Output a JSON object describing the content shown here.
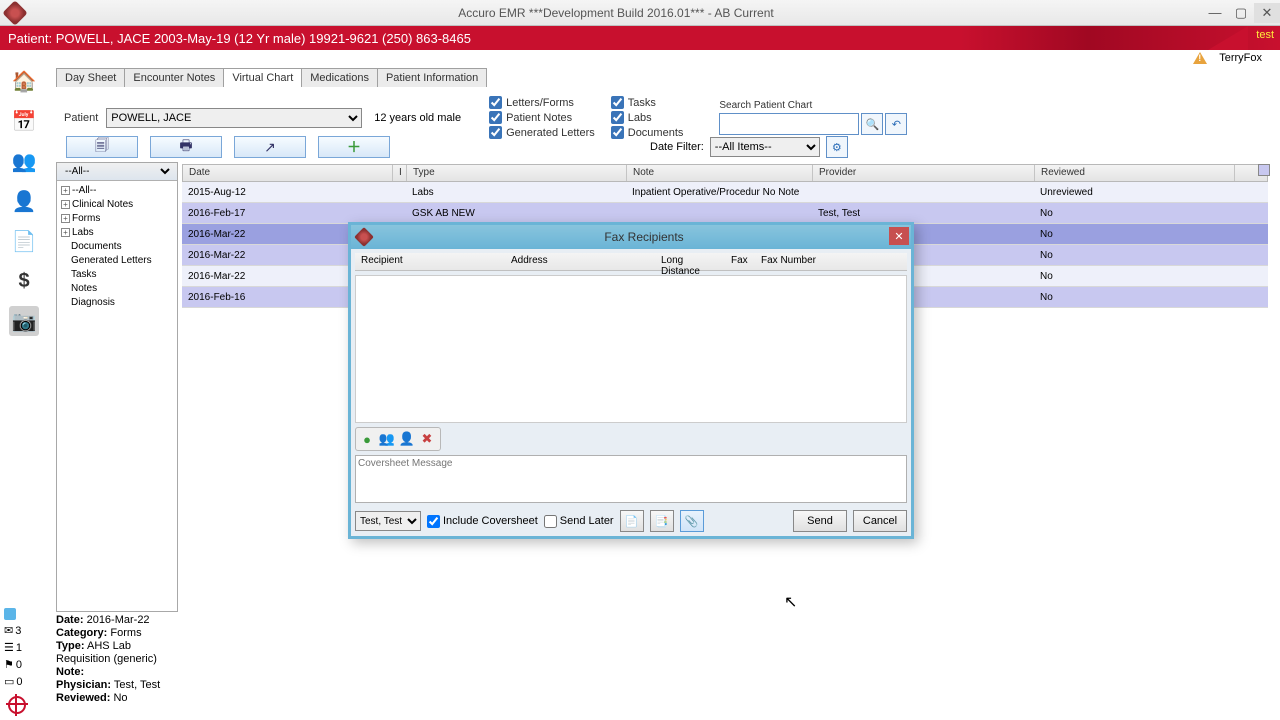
{
  "window": {
    "title": "Accuro EMR ***Development Build 2016.01***  -  AB Current",
    "test_tag": "test"
  },
  "patient_banner": "Patient: POWELL, JACE 2003-May-19 (12 Yr male) 19921-9621 (250) 863-8465",
  "user": "TerryFox",
  "tabs": [
    "Day Sheet",
    "Encounter Notes",
    "Virtual Chart",
    "Medications",
    "Patient Information"
  ],
  "active_tab": "Virtual Chart",
  "patient_row": {
    "label": "Patient",
    "patient": "POWELL, JACE",
    "age": "12 years old male",
    "filters": {
      "letters_forms": "Letters/Forms",
      "patient_notes": "Patient Notes",
      "generated_letters": "Generated Letters",
      "tasks": "Tasks",
      "labs": "Labs",
      "documents": "Documents"
    },
    "search_label": "Search Patient Chart",
    "date_filter_label": "Date Filter:",
    "date_filter_value": "--All Items--"
  },
  "tree": {
    "header": "--All--",
    "items": [
      "--All--",
      "Clinical Notes",
      "Forms",
      "Labs",
      "Documents",
      "Generated Letters",
      "Tasks",
      "Notes",
      "Diagnosis"
    ]
  },
  "table": {
    "cols": {
      "date": "Date",
      "i": "I",
      "type": "Type",
      "note": "Note",
      "provider": "Provider",
      "reviewed": "Reviewed"
    },
    "rows": [
      {
        "date": "2015-Aug-12",
        "type": "Labs",
        "note": "Inpatient Operative/Procedur No Note",
        "prov": "",
        "rev": "Unreviewed"
      },
      {
        "date": "2016-Feb-17",
        "type": "GSK AB NEW",
        "note": "",
        "prov": "Test, Test",
        "rev": "No"
      },
      {
        "date": "2016-Mar-22",
        "type": "",
        "note": "",
        "prov": "",
        "rev": "No"
      },
      {
        "date": "2016-Mar-22",
        "type": "",
        "note": "",
        "prov": "",
        "rev": "No"
      },
      {
        "date": "2016-Mar-22",
        "type": "",
        "note": "",
        "prov": "",
        "rev": "No"
      },
      {
        "date": "2016-Feb-16",
        "type": "",
        "note": "",
        "prov": "",
        "rev": "No"
      }
    ]
  },
  "detail": {
    "date_l": "Date:",
    "date_v": "2016-Mar-22",
    "cat_l": "Category:",
    "cat_v": "Forms",
    "type_l": "Type:",
    "type_v": "AHS Lab Requisition (generic)",
    "note_l": "Note:",
    "note_v": "",
    "phys_l": "Physician:",
    "phys_v": "Test, Test",
    "rev_l": "Reviewed:",
    "rev_v": "No"
  },
  "rail_counts": {
    "a": "3",
    "b": "1",
    "c": "0",
    "d": "0"
  },
  "dialog": {
    "title": "Fax Recipients",
    "cols": {
      "rec": "Recipient",
      "addr": "Address",
      "ld": "Long Distance",
      "fx": "Fax",
      "fn": "Fax Number"
    },
    "msg_placeholder": "Coversheet Message",
    "sender": "Test, Test",
    "include_cs": "Include Coversheet",
    "send_later": "Send Later",
    "send": "Send",
    "cancel": "Cancel"
  }
}
